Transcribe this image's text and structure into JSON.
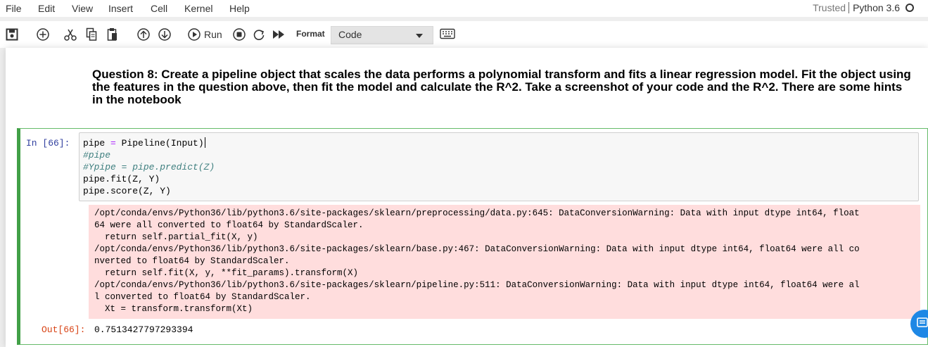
{
  "menubar": {
    "items": [
      "File",
      "Edit",
      "View",
      "Insert",
      "Cell",
      "Kernel",
      "Help"
    ],
    "trusted": "Trusted",
    "kernel": "Python 3.6"
  },
  "toolbar": {
    "run_label": "Run",
    "format_label": "Format",
    "cell_type": "Code",
    "icons": [
      "save-icon",
      "add-cell-icon",
      "cut-icon",
      "copy-icon",
      "paste-icon",
      "move-up-icon",
      "move-down-icon",
      "run-icon",
      "stop-icon",
      "restart-icon",
      "fast-forward-icon",
      "keyboard-icon"
    ]
  },
  "markdown": {
    "text": "Question 8: Create a pipeline object that scales the data performs a polynomial transform and fits a linear regression model. Fit the object using the features in the question above, then fit the model and calculate the R^2. Take a screenshot of your code and the R^2. There are some hints in the notebook"
  },
  "cell": {
    "in_prompt": "In [66]:",
    "code": {
      "line1_a": "pipe ",
      "line1_op": "=",
      "line1_b": " Pipeline(Input)",
      "line2": "#pipe",
      "line3": "#Ypipe = pipe.predict(Z)",
      "line4": "pipe.fit(Z, Y)",
      "line5": "pipe.score(Z, Y)"
    },
    "stderr": [
      "/opt/conda/envs/Python36/lib/python3.6/site-packages/sklearn/preprocessing/data.py:645: DataConversionWarning: Data with input dtype int64, float",
      "64 were all converted to float64 by StandardScaler.",
      "  return self.partial_fit(X, y)",
      "/opt/conda/envs/Python36/lib/python3.6/site-packages/sklearn/base.py:467: DataConversionWarning: Data with input dtype int64, float64 were all co",
      "nverted to float64 by StandardScaler.",
      "  return self.fit(X, y, **fit_params).transform(X)",
      "/opt/conda/envs/Python36/lib/python3.6/site-packages/sklearn/pipeline.py:511: DataConversionWarning: Data with input dtype int64, float64 were al",
      "l converted to float64 by StandardScaler.",
      "  Xt = transform.transform(Xt)"
    ],
    "out_prompt": "Out[66]:",
    "output": "0.7513427797293394"
  },
  "colors": {
    "accent": "#1e88e5",
    "cell_border": "#42a047",
    "in_prompt": "#303f9f",
    "out_prompt": "#d84315",
    "stderr_bg": "#ffdddd"
  }
}
